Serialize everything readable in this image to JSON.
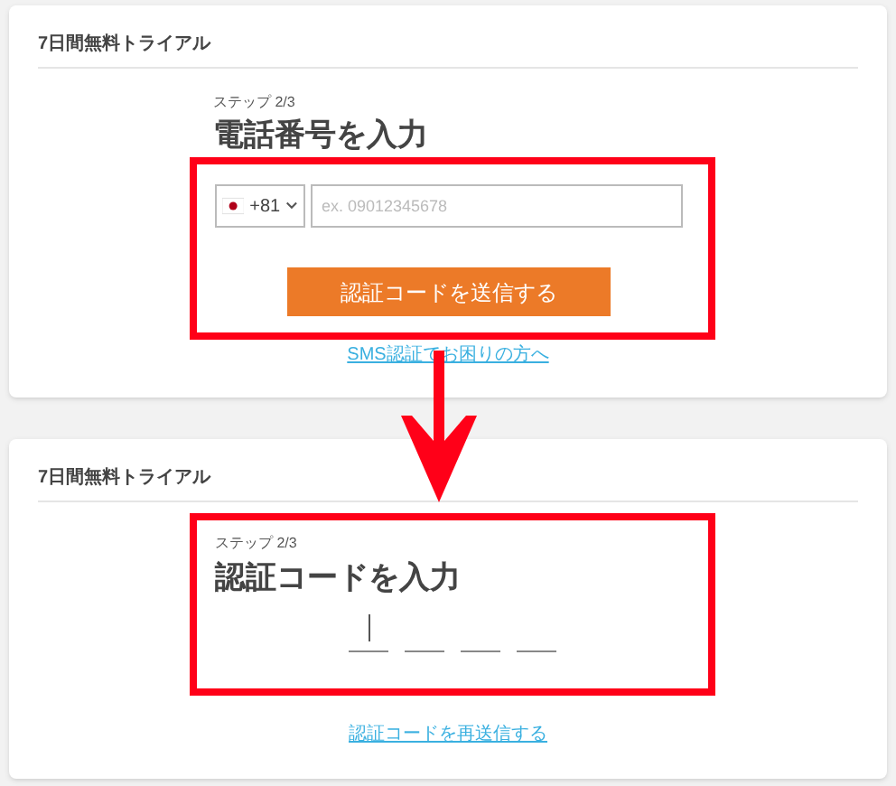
{
  "phone_card": {
    "header": "7日間無料トライアル",
    "step": "ステップ 2/3",
    "title": "電話番号を入力",
    "country_code": "+81",
    "phone_field": {
      "placeholder": "ex. 09012345678"
    },
    "send_button": "認証コードを送信する",
    "help_link": "SMS認証でお困りの方へ"
  },
  "code_card": {
    "header": "7日間無料トライアル",
    "step": "ステップ 2/3",
    "title": "認証コードを入力",
    "code_slots": [
      {
        "focused": true
      },
      {
        "focused": false
      },
      {
        "focused": false
      },
      {
        "focused": false
      }
    ],
    "resend_link": "認証コードを再送信する"
  }
}
